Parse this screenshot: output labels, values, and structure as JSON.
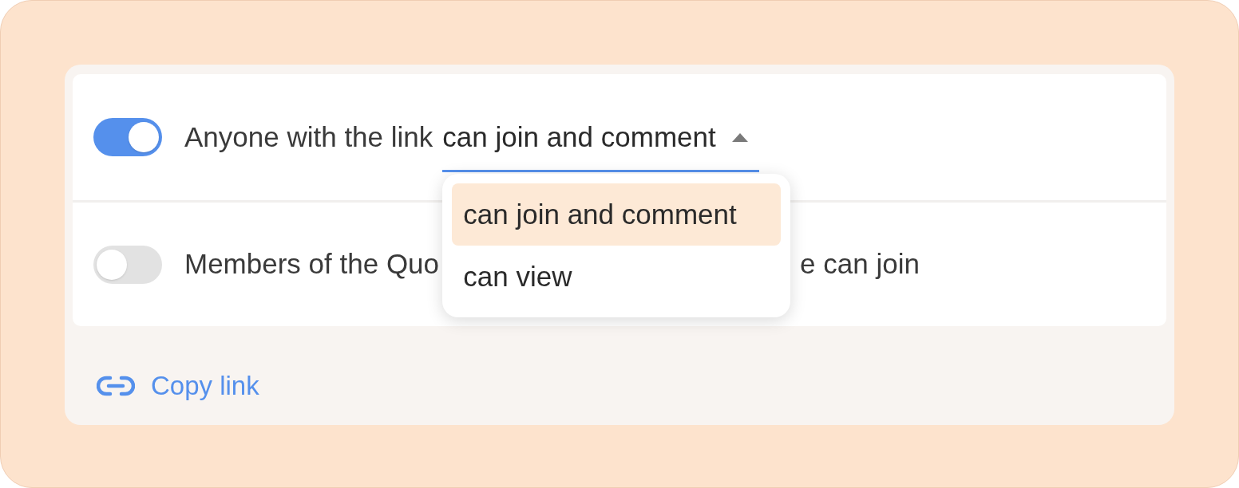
{
  "sharing_options": [
    {
      "kind": "link",
      "on": true,
      "label": "Anyone with the link",
      "permission": {
        "value": "can join and comment",
        "expanded": true,
        "options": [
          {
            "label": "can join and comment",
            "selected": true
          },
          {
            "label": "can view",
            "selected": false
          }
        ]
      }
    },
    {
      "kind": "members",
      "on": false,
      "label_before": "Members of the Quo",
      "label_after": "e can join"
    }
  ],
  "copy_link": {
    "label": "Copy link"
  }
}
